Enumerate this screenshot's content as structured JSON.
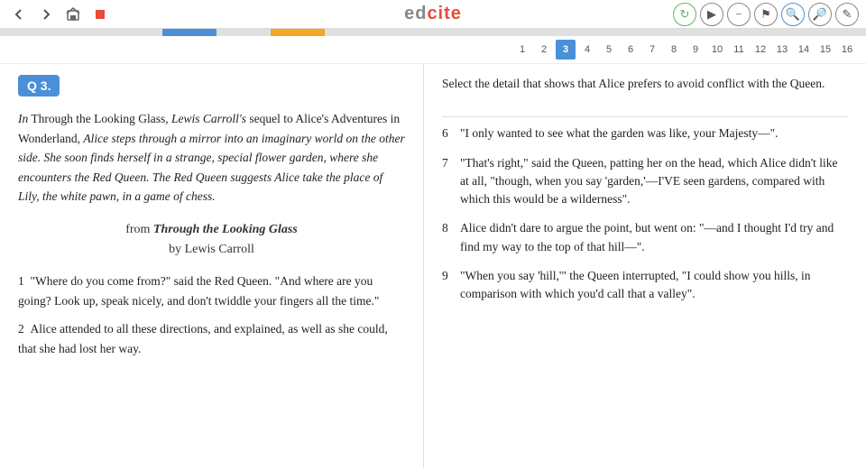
{
  "topbar": {
    "logo_ed": "ed",
    "logo_cite": "cite",
    "nav_back_label": "◀",
    "nav_forward_label": "▶",
    "nav_bookmark_label": "⊞",
    "nav_stop_label": "■"
  },
  "progress": {
    "segments": [
      {
        "color": "#e0e0e0"
      },
      {
        "color": "#e0e0e0"
      },
      {
        "color": "#e0e0e0"
      },
      {
        "color": "#4a90d9"
      },
      {
        "color": "#e0e0e0"
      },
      {
        "color": "#f5a623"
      },
      {
        "color": "#e0e0e0"
      },
      {
        "color": "#e0e0e0"
      },
      {
        "color": "#e0e0e0"
      },
      {
        "color": "#e0e0e0"
      },
      {
        "color": "#e0e0e0"
      },
      {
        "color": "#e0e0e0"
      },
      {
        "color": "#e0e0e0"
      },
      {
        "color": "#e0e0e0"
      },
      {
        "color": "#e0e0e0"
      },
      {
        "color": "#e0e0e0"
      }
    ]
  },
  "question_bar": {
    "numbers": [
      1,
      2,
      3,
      4,
      5,
      6,
      7,
      8,
      9,
      10,
      11,
      12,
      13,
      14,
      15,
      16
    ],
    "active": 3
  },
  "question_label": "Q 3.",
  "passage": {
    "intro_text_1": "In Through the Looking Glass, ",
    "intro_text_2": "Lewis Carroll's",
    "intro_text_3": " sequel to Alice's Adventures in Wonderland, ",
    "intro_italic": "Alice steps through a mirror into an imaginary world on the other side. She soon finds herself in a strange, special flower garden, where she encounters the Red Queen. The Red Queen suggests Alice take the place of Lily, the white pawn, in a game of chess.",
    "attribution_from": "from ",
    "book_title": "Through the Looking Glass",
    "author": "by Lewis Carroll",
    "paragraphs": [
      {
        "num": "1",
        "text": "\"Where do you come from?\" said the Red Queen. \"And where are you going? Look up, speak nicely, and don't twiddle your fingers all the time.\""
      },
      {
        "num": "2",
        "text": "Alice attended to all these directions, and explained, as well as she could, that she had lost her way."
      }
    ]
  },
  "question": {
    "prompt": "Select the detail that shows that Alice prefers to avoid conflict with the Queen.",
    "options": [
      {
        "num": "6",
        "text": "\"I only wanted to see what the garden was like, your Majesty—\"."
      },
      {
        "num": "7",
        "text": "\"That's right,\" said the Queen, patting her on the head, which Alice didn't like at all, \"though, when you say 'garden,'—I'VE seen gardens, compared with which this would be a wilderness\"."
      },
      {
        "num": "8",
        "text": "Alice didn't dare to argue the point, but went on: \"—and I thought I'd try and find my way to the top of that hill—\"."
      },
      {
        "num": "9",
        "text": "\"When you say 'hill,'\" the Queen interrupted, \"I could show you hills, in comparison with which you'd call that a valley\"."
      }
    ]
  }
}
